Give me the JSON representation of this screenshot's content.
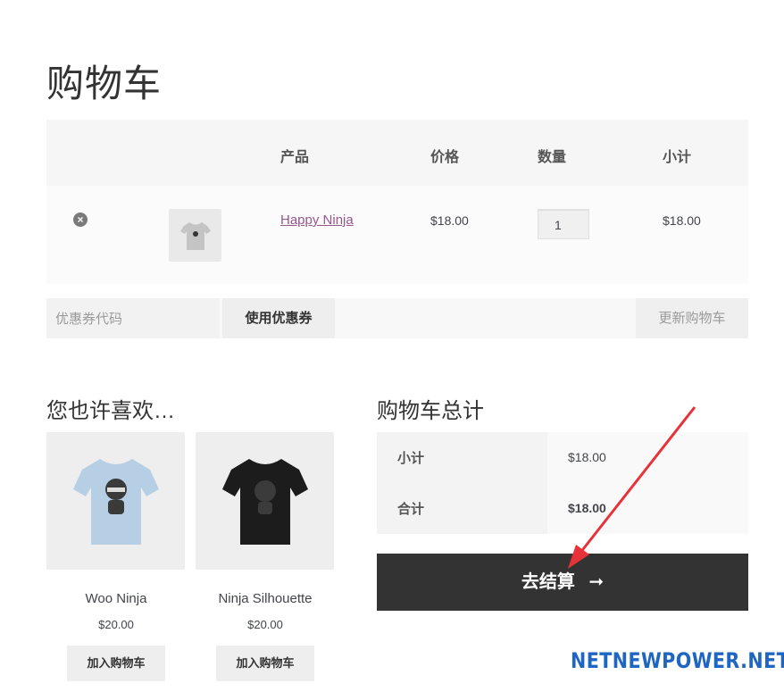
{
  "page": {
    "title": "购物车"
  },
  "cart": {
    "headers": {
      "product": "产品",
      "price": "价格",
      "quantity": "数量",
      "subtotal": "小计"
    },
    "items": [
      {
        "name": "Happy Ninja",
        "price": "$18.00",
        "quantity": "1",
        "subtotal": "$18.00",
        "icon": "tshirt-gray-icon"
      }
    ],
    "coupon": {
      "placeholder": "优惠券代码",
      "apply_label": "使用优惠券"
    },
    "update_label": "更新购物车"
  },
  "cross_sells": {
    "title": "您也许喜欢…",
    "items": [
      {
        "name": "Woo Ninja",
        "price": "$20.00",
        "button": "加入购物车",
        "icon": "tshirt-lightblue-icon",
        "color": "#b7cfe4"
      },
      {
        "name": "Ninja Silhouette",
        "price": "$20.00",
        "button": "加入购物车",
        "icon": "tshirt-black-icon",
        "color": "#1c1c1c"
      }
    ]
  },
  "totals": {
    "title": "购物车总计",
    "rows": [
      {
        "label": "小计",
        "value": "$18.00"
      },
      {
        "label": "合计",
        "value": "$18.00"
      }
    ],
    "checkout_label": "去结算",
    "checkout_icon": "arrow-right-icon"
  },
  "watermark": "NETNEWPOWER.NET",
  "colors": {
    "link": "#96588a",
    "checkout_bg": "#333333",
    "annotation_arrow": "#e8323a",
    "watermark": "#1f66c4"
  }
}
